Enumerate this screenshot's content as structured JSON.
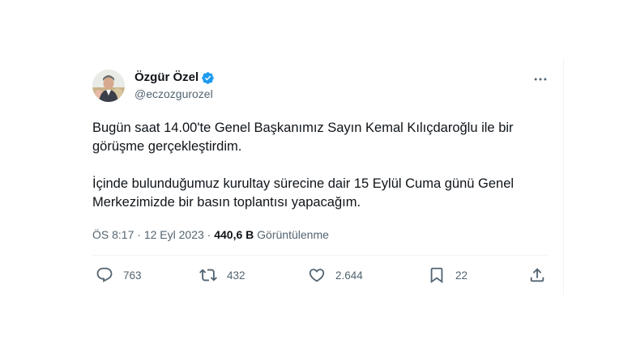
{
  "author": {
    "display_name": "Özgür Özel",
    "handle": "@eczozgurozel",
    "verified_color": "#1d9bf0"
  },
  "tweet": {
    "paragraphs": [
      "Bugün saat 14.00'te Genel Başkanımız Sayın Kemal Kılıçdaroğlu ile bir görüşme gerçekleştirdim.",
      "İçinde bulunduğumuz kurultay sürecine dair 15 Eylül Cuma günü Genel Merkezimizde bir basın toplantısı yapacağım."
    ],
    "time": "ÖS 8:17",
    "separator": "·",
    "date": "12 Eyl 2023",
    "views_count": "440,6 B",
    "views_label": "Görüntülenme"
  },
  "actions": {
    "replies": {
      "icon": "reply-icon",
      "count": "763"
    },
    "reposts": {
      "icon": "repost-icon",
      "count": "432"
    },
    "likes": {
      "icon": "heart-icon",
      "count": "2.644"
    },
    "bookmarks": {
      "icon": "bookmark-icon",
      "count": "22"
    },
    "share": {
      "icon": "share-icon"
    }
  },
  "icons": {
    "more": "more-icon",
    "verified": "verified-badge-icon"
  }
}
